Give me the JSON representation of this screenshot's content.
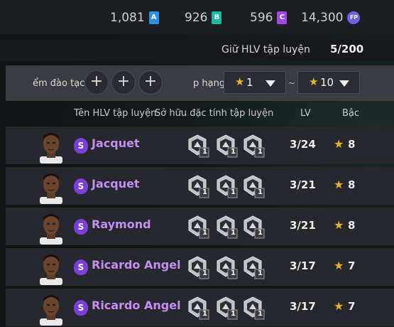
{
  "currencies": {
    "a": {
      "value": "1,081",
      "icon": "A"
    },
    "b": {
      "value": "926",
      "icon": "B"
    },
    "c": {
      "value": "596",
      "icon": "C"
    },
    "fp": {
      "value": "14,300",
      "icon": "FP"
    }
  },
  "slots": {
    "label": "Giữ HLV tập luyện",
    "count": "5/200"
  },
  "filters": {
    "training_label": "ểm đào tạc",
    "rank_label": "p hạng",
    "plus": "+",
    "rank_from": "1",
    "rank_to": "10",
    "separator": "~",
    "star": "★"
  },
  "columns": {
    "name": "Tên HLV tập luyện",
    "owned_traits": "Sở hữu đặc tính tập luyện",
    "lv": "LV",
    "grade": "Bậc"
  },
  "coaches": [
    {
      "badge": "S",
      "name": "Jacquet",
      "lv": "3/24",
      "grade": "8",
      "traits": [
        "1",
        "1",
        "1"
      ],
      "icons": [
        "fitness-icon",
        "goalkeeper-icon",
        "training-icon"
      ]
    },
    {
      "badge": "S",
      "name": "Jacquet",
      "lv": "3/21",
      "grade": "8",
      "traits": [
        "1",
        "1",
        "1"
      ],
      "icons": [
        "speed-icon",
        "training-icon",
        "dribble-icon"
      ]
    },
    {
      "badge": "S",
      "name": "Raymond",
      "lv": "3/21",
      "grade": "8",
      "traits": [
        "1",
        "1",
        "1"
      ],
      "icons": [
        "target-icon",
        "training-icon",
        "lock-icon"
      ]
    },
    {
      "badge": "S",
      "name": "Ricardo Angel",
      "lv": "3/17",
      "grade": "7",
      "traits": [
        "1",
        "1",
        "1"
      ],
      "icons": [
        "training-icon",
        "shooting-icon",
        "dribble-icon"
      ]
    },
    {
      "badge": "S",
      "name": "Ricardo Angel",
      "lv": "3/17",
      "grade": "7",
      "traits": [
        "1",
        "1",
        "1"
      ],
      "icons": [
        "training-icon",
        "shooting-icon",
        "dribble-icon"
      ]
    }
  ],
  "colors": {
    "accent_purple": "#7a3fd6",
    "name_purple": "#c48ef5",
    "star_gold": "#e5b02a"
  }
}
